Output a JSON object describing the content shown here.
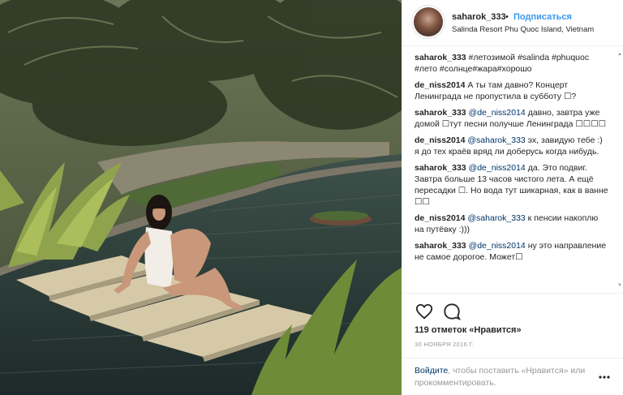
{
  "post": {
    "username": "saharok_333",
    "separator": "•",
    "follow_label": "Подписаться",
    "location": "Salinda Resort Phu Quoc Island, Vietnam"
  },
  "comments": [
    {
      "author": "saharok_333",
      "text": " #летозимой #salinda #phuquoc #лето #солнце#жара#хорошо"
    },
    {
      "author": "de_niss2014",
      "text": " А ты там давно? Концерт Ленинграда не пропустила в субботу ☐?"
    },
    {
      "author": "saharok_333",
      "mention": " @de_niss2014",
      "text": " давно, завтра уже домой ☐тут песни получше Ленинграда ☐☐☐☐"
    },
    {
      "author": "de_niss2014",
      "mention": " @saharok_333",
      "text": " эх, завидую тебе :) я до тех краёв вряд ли доберусь когда нибудь."
    },
    {
      "author": "saharok_333",
      "mention": " @de_niss2014",
      "text": " да. Это подвиг. Завтра больше 13 часов чистого лета. А ещё пересадки ☐. Но вода тут шикарная, как в ванне ☐☐"
    },
    {
      "author": "de_niss2014",
      "mention": " @saharok_333",
      "text": " к пенсии накоплю на путёвку :)))"
    },
    {
      "author": "saharok_333",
      "mention": " @de_niss2014",
      "text": " ну это направление не самое дорогое. Может☐"
    }
  ],
  "actions": {
    "like_icon": "heart-icon",
    "comment_icon": "comment-bubble-icon"
  },
  "likes_text": "119 отметок «Нравится»",
  "date_text": "30 НОЯБРЯ 2016 Г.",
  "login": {
    "login_link": "Войдите",
    "text": ", чтобы поставить «Нравится» или прокомментировать."
  },
  "colors": {
    "accent": "#3897f0",
    "link": "#003569",
    "muted": "#999999"
  }
}
